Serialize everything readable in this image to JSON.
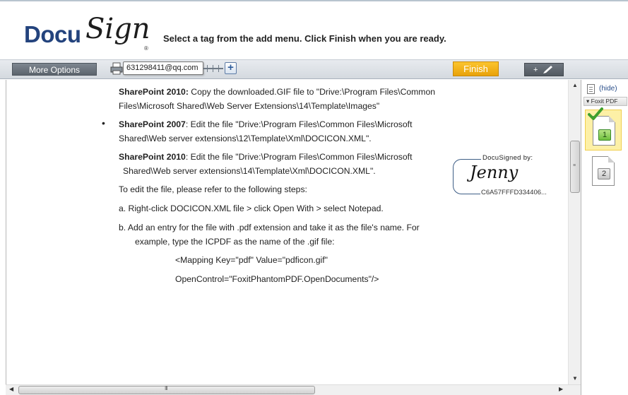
{
  "brand": {
    "logo_left": "Docu",
    "logo_right": "Sign",
    "registered": "®"
  },
  "header": {
    "instruction": "Select a tag from the add menu. Click Finish when you are ready."
  },
  "toolbar": {
    "more_options_label": "More Options",
    "email_tag_value": "631298411@qq.com",
    "zoom_plus": "+",
    "finish_label": "Finish",
    "add_menu_plus": "+"
  },
  "document": {
    "lines": [
      {
        "bold": "SharePoint 2010:",
        "text": " Copy the downloaded.GIF file to \"Drive:\\Program Files\\Common"
      },
      {
        "bold": "",
        "text": "Files\\Microsoft Shared\\Web Server Extensions\\14\\Template\\Images\""
      },
      {
        "bold": "SharePoint 2007",
        "text": ": Edit the file \"Drive:\\Program Files\\Common Files\\Microsoft"
      },
      {
        "bold": "",
        "text": "Shared\\Web server extensions\\12\\Template\\Xml\\DOCICON.XML\"."
      },
      {
        "bold": "SharePoint 2010",
        "text": ": Edit the file \"Drive:\\Program Files\\Common Files\\Microsoft"
      },
      {
        "bold": "",
        "text": "Shared\\Web server extensions\\14\\Template\\Xml\\DOCICON.XML\"."
      },
      {
        "bold": "",
        "text": "To edit the file, please refer to the following steps:"
      },
      {
        "bold": "",
        "text": "a.   Right-click DOCICON.XML file > click Open With > select Notepad."
      },
      {
        "bold": "",
        "text": "b.   Add an entry for the file with .pdf extension and take it as the file's name. For"
      },
      {
        "bold": "",
        "text": "example, type the ICPDF as the name of the .gif file:"
      },
      {
        "bold": "",
        "text": "<Mapping Key=\"pdf\" Value=\"pdficon.gif\""
      },
      {
        "bold": "",
        "text": "OpenControl=\"FoxitPhantomPDF.OpenDocuments\"/>"
      }
    ],
    "bullet": "•"
  },
  "signature": {
    "label": "DocuSigned by:",
    "name": "Jenny",
    "id": "C6A57FFFD334406..."
  },
  "sidepanel": {
    "hide_link": "(hide)",
    "tab_label": "▾ Foxit PDF",
    "pages": [
      "1",
      "2"
    ]
  },
  "scrollbar": {
    "grip_h": "III",
    "grip_v": "≡"
  }
}
